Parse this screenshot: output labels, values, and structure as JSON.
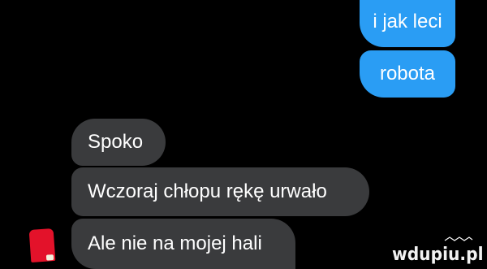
{
  "chat": {
    "messages": [
      {
        "direction": "outgoing",
        "text": "i jak leci"
      },
      {
        "direction": "outgoing",
        "text": "robota"
      },
      {
        "direction": "incoming",
        "text": "Spoko"
      },
      {
        "direction": "incoming",
        "text": "Wczoraj chłopu rękę urwało"
      },
      {
        "direction": "incoming",
        "text": "Ale nie na mojej hali"
      }
    ],
    "sender_avatar": {
      "icon": "avatar-icon",
      "color": "#e3122a"
    }
  },
  "watermark": {
    "text": "wdupiu.pl",
    "icon": "logo-mark-icon"
  },
  "colors": {
    "background": "#000000",
    "outgoing_bubble": "#2a9df4",
    "incoming_bubble": "#3a3b3d",
    "text": "#ffffff"
  }
}
